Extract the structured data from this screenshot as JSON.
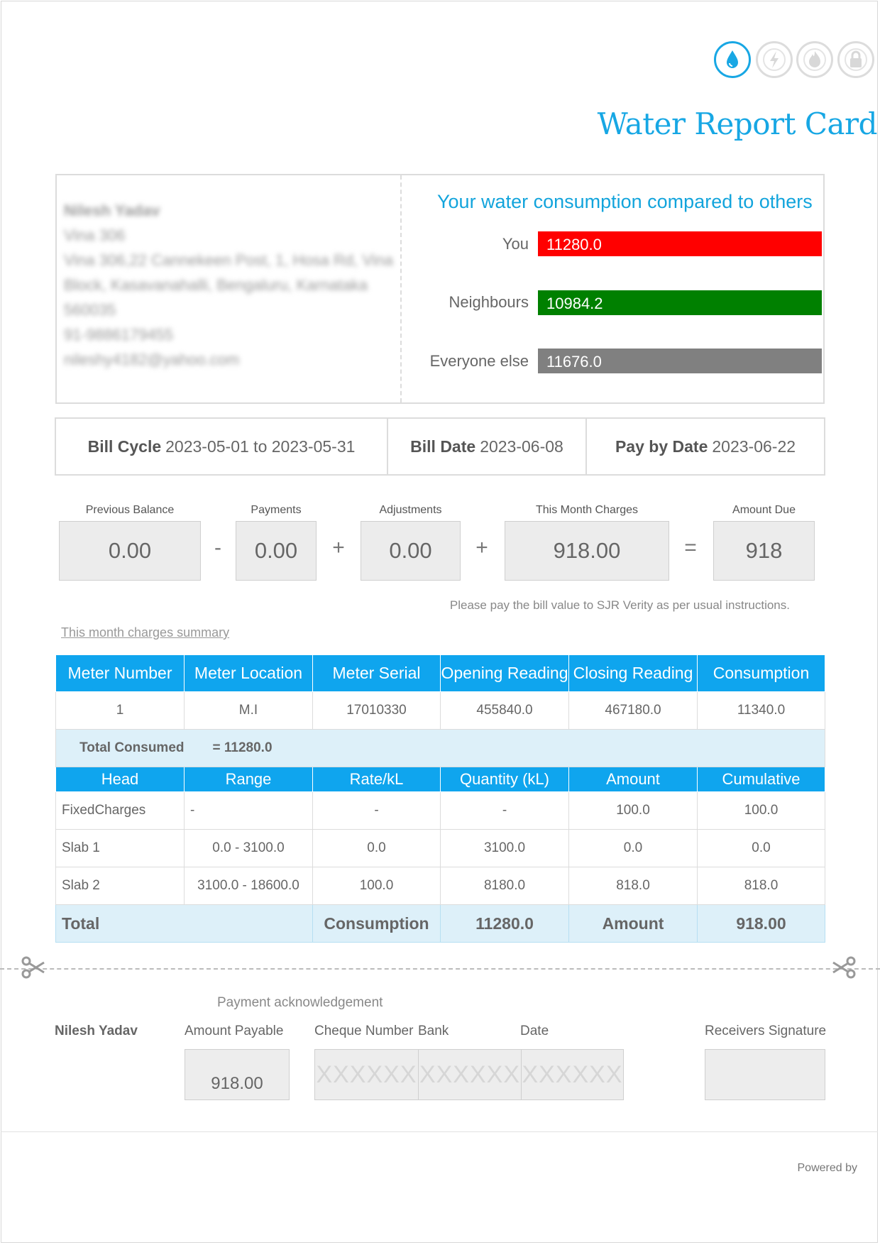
{
  "header": {
    "icons": [
      "water-drop-icon",
      "lightning-icon",
      "flame-icon",
      "lock-icon"
    ],
    "title": "Water Report Card"
  },
  "customer": {
    "name": "Nilesh Yadav",
    "address_lines": [
      "Vina 306",
      "Vina 306,22 Cannekeen Post, 1, Hosa Rd, Vina",
      "Block, Kasavanahalli, Bengaluru, Karnataka",
      "560035",
      "91-9886179455",
      "nileshy4182@yahoo.com"
    ]
  },
  "comparison": {
    "title": "Your water consumption compared to others",
    "rows": [
      {
        "label": "You",
        "value": "11280.0",
        "color": "#ff0000"
      },
      {
        "label": "Neighbours",
        "value": "10984.2",
        "color": "#008000"
      },
      {
        "label": "Everyone else",
        "value": "11676.0",
        "color": "#808080"
      }
    ]
  },
  "bill": {
    "cycle_label": "Bill Cycle",
    "cycle_value": "2023-05-01 to 2023-05-31",
    "date_label": "Bill Date",
    "date_value": "2023-06-08",
    "pay_label": "Pay by Date",
    "pay_value": "2023-06-22"
  },
  "balance": {
    "previous_label": "Previous Balance",
    "previous_value": "0.00",
    "payments_label": "Payments",
    "payments_value": "0.00",
    "adjustments_label": "Adjustments",
    "adjustments_value": "0.00",
    "charges_label": "This Month Charges",
    "charges_value": "918.00",
    "due_label": "Amount Due",
    "due_value": "918",
    "op_minus": "-",
    "op_plus": "+",
    "op_equals": "=",
    "note": "Please pay the bill value to SJR Verity as per usual instructions."
  },
  "summary_link": "This month charges summary",
  "meter_table": {
    "headers": [
      "Meter Number",
      "Meter Location",
      "Meter Serial",
      "Opening Reading",
      "Closing Reading",
      "Consumption"
    ],
    "rows": [
      [
        "1",
        "M.I",
        "17010330",
        "455840.0",
        "467180.0",
        "11340.0"
      ]
    ],
    "total_consumed_label": "Total Consumed",
    "total_consumed_value": "= 11280.0"
  },
  "slab_table": {
    "headers": [
      "Head",
      "Range",
      "Rate/kL",
      "Quantity (kL)",
      "Amount",
      "Cumulative"
    ],
    "rows": [
      [
        "FixedCharges",
        "-",
        "-",
        "-",
        "100.0",
        "100.0"
      ],
      [
        "Slab 1",
        "0.0 - 3100.0",
        "0.0",
        "3100.0",
        "0.0",
        "0.0"
      ],
      [
        "Slab 2",
        "3100.0 - 18600.0",
        "100.0",
        "8180.0",
        "818.0",
        "818.0"
      ]
    ],
    "total": {
      "label": "Total",
      "consumption_label": "Consumption",
      "consumption_value": "11280.0",
      "amount_label": "Amount",
      "amount_value": "918.00"
    }
  },
  "acknowledgement": {
    "title": "Payment acknowledgement",
    "name": "Nilesh Yadav",
    "amount_label": "Amount Payable",
    "amount_value": "918.00",
    "cheque_label": "Cheque Number",
    "bank_label": "Bank",
    "date_label": "Date",
    "placeholder": "XXXXXX",
    "signature_label": "Receivers Signature"
  },
  "footer": {
    "powered_by": "Powered by"
  }
}
